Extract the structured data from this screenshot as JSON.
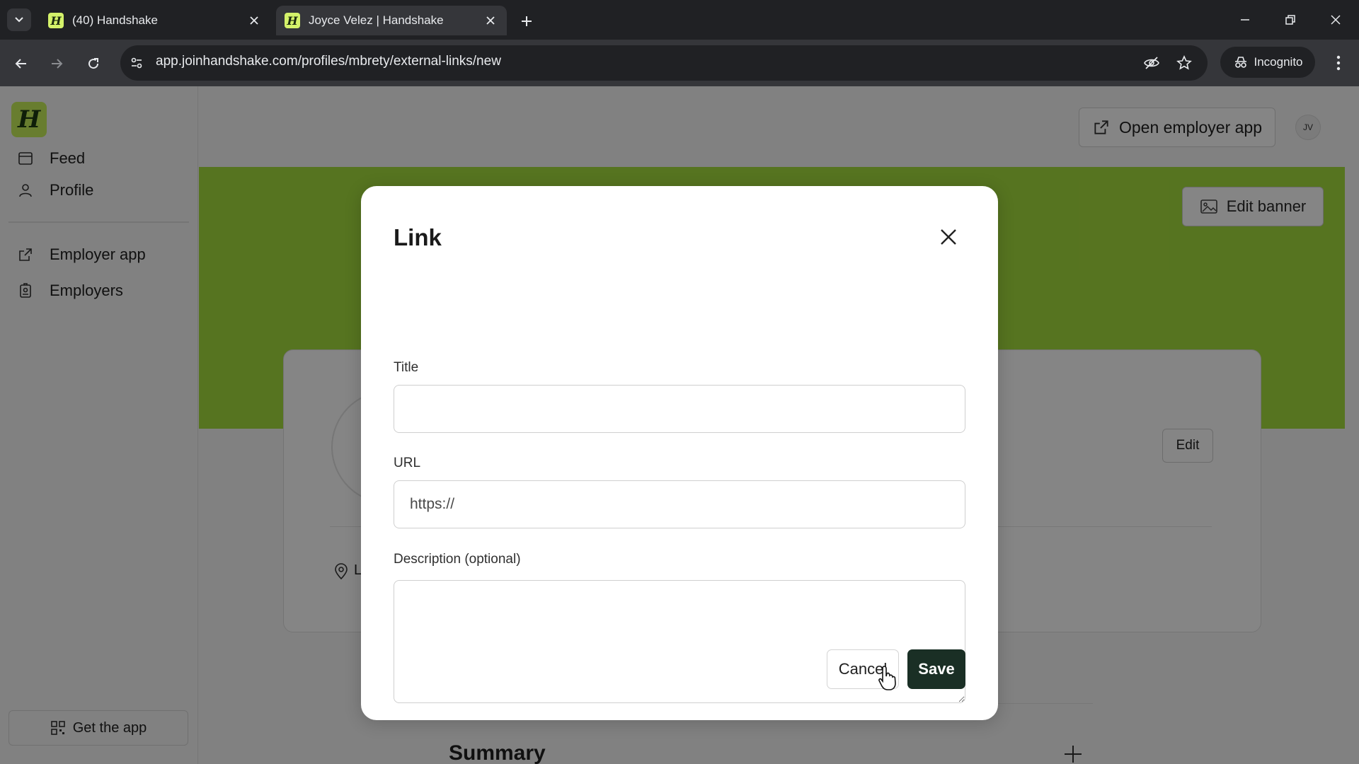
{
  "browser": {
    "tabs": [
      {
        "title": "(40) Handshake",
        "active": false,
        "favicon": "H"
      },
      {
        "title": "Joyce Velez | Handshake",
        "active": true,
        "favicon": "H"
      }
    ],
    "url": "app.joinhandshake.com/profiles/mbrety/external-links/new",
    "incognito_label": "Incognito"
  },
  "sidebar": {
    "logo": "H",
    "items": [
      {
        "label": "Feed",
        "icon": "feed-icon"
      },
      {
        "label": "Profile",
        "icon": "person-icon"
      },
      {
        "label": "Employer app",
        "icon": "external-link-icon"
      },
      {
        "label": "Employers",
        "icon": "badge-icon"
      }
    ],
    "get_app_label": "Get the app"
  },
  "header": {
    "open_employer_app_label": "Open employer app",
    "avatar_initials": "JV"
  },
  "profile": {
    "edit_banner_label": "Edit banner",
    "edit_label": "Edit",
    "location_partial": "L",
    "summary_title": "Summary"
  },
  "modal": {
    "title": "Link",
    "fields": {
      "title_label": "Title",
      "title_value": "",
      "url_label": "URL",
      "url_placeholder": "https://",
      "description_label": "Description (optional)",
      "description_value": ""
    },
    "cancel_label": "Cancel",
    "save_label": "Save"
  },
  "colors": {
    "banner": "#a6de3e",
    "logo_bg": "#c7f05a",
    "save_button": "#1a2f25",
    "chrome_dark": "#202124",
    "chrome_toolbar": "#35363a"
  }
}
